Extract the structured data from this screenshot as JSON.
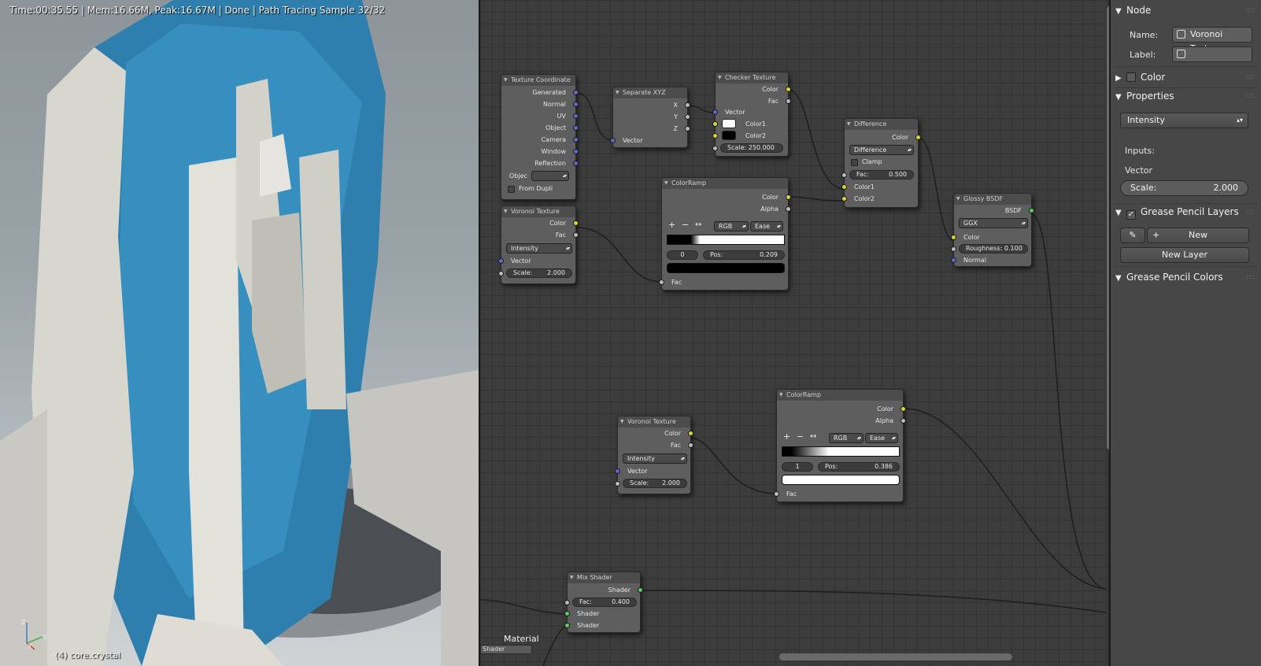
{
  "viewport": {
    "status": "Time:00:35.55 | Mem:16.66M, Peak:16.67M | Done | Path Tracing Sample 32/32",
    "object_label": "(4) core.crystal",
    "axes": {
      "x": "X",
      "y": "Y",
      "z": "Z"
    }
  },
  "nodes": {
    "texcoord": {
      "title": "Texture Coordinate",
      "outputs": [
        "Generated",
        "Normal",
        "UV",
        "Object",
        "Camera",
        "Window",
        "Reflection"
      ],
      "object_label": "Objec",
      "from_dupli": "From Dupli"
    },
    "separate": {
      "title": "Separate XYZ",
      "outputs": [
        "X",
        "Y",
        "Z"
      ],
      "input": "Vector"
    },
    "checker": {
      "title": "Checker Texture",
      "outputs": [
        "Color",
        "Fac"
      ],
      "inputs": [
        "Vector",
        "Color1",
        "Color2"
      ],
      "scale_label": "Scale:",
      "scale_value": "250.000",
      "color1": "#ffffff",
      "color2": "#000000"
    },
    "difference": {
      "title": "Difference",
      "mode": "Difference",
      "clamp": "Clamp",
      "output": "Color",
      "fac_label": "Fac:",
      "fac_value": "0.500",
      "inputs": [
        "Color1",
        "Color2"
      ]
    },
    "glossy": {
      "title": "Glossy BSDF",
      "output": "BSDF",
      "distribution": "GGX",
      "inputs": [
        "Color",
        "Normal"
      ],
      "roughness_label": "Roughness:",
      "roughness_value": "0.100"
    },
    "ramp1": {
      "title": "ColorRamp",
      "outputs": [
        "Color",
        "Alpha"
      ],
      "mode": "RGB",
      "interp": "Ease",
      "index": "0",
      "pos_label": "Pos:",
      "pos_value": "0.209",
      "input": "Fac",
      "stop_color": "#000000"
    },
    "voronoi1": {
      "title": "Voronoi Texture",
      "outputs": [
        "Color",
        "Fac"
      ],
      "coloring": "Intensity",
      "input": "Vector",
      "scale_label": "Scale:",
      "scale_value": "2.000"
    },
    "voronoi2": {
      "title": "Voronoi Texture",
      "outputs": [
        "Color",
        "Fac"
      ],
      "coloring": "Intensity",
      "input": "Vector",
      "scale_label": "Scale:",
      "scale_value": "2.000"
    },
    "ramp2": {
      "title": "ColorRamp",
      "outputs": [
        "Color",
        "Alpha"
      ],
      "mode": "RGB",
      "interp": "Ease",
      "index": "1",
      "pos_label": "Pos:",
      "pos_value": "0.386",
      "input": "Fac",
      "stop_color": "#ffffff"
    },
    "mix": {
      "title": "Mix Shader",
      "output": "Shader",
      "fac_label": "Fac:",
      "fac_value": "0.400",
      "inputs": [
        "Shader",
        "Shader"
      ]
    },
    "material_frame": {
      "label": "Material",
      "sublabel": "Shader"
    }
  },
  "properties": {
    "node_header": "Node",
    "name_label": "Name:",
    "name_value": "Voronoi Textu...",
    "label_label": "Label:",
    "label_value": "",
    "color_header": "Color",
    "properties_header": "Properties",
    "coloring": "Intensity",
    "inputs_label": "Inputs:",
    "vector_label": "Vector",
    "scale_label": "Scale:",
    "scale_value": "2.000",
    "gp_layers_header": "Grease Pencil Layers",
    "new_button": "New",
    "new_layer_button": "New Layer",
    "gp_colors_header": "Grease Pencil Colors"
  }
}
